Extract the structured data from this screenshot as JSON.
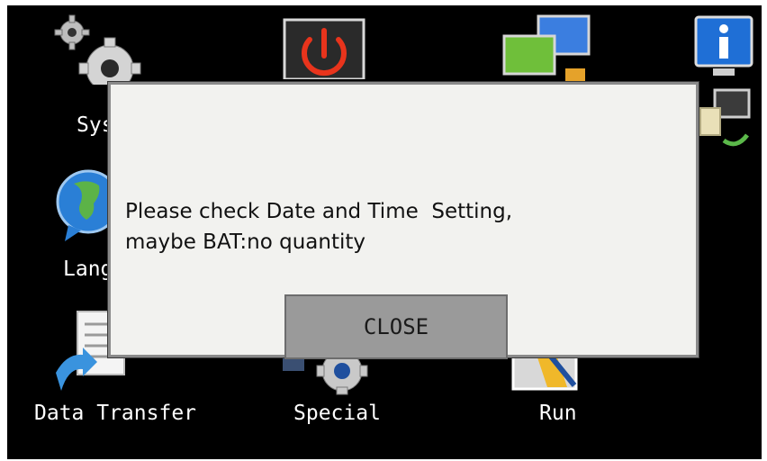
{
  "icons": {
    "system": {
      "label": "Sys",
      "icon": "gear-icon"
    },
    "power": {
      "icon": "power-icon"
    },
    "display": {
      "icon": "monitor-icon"
    },
    "info": {
      "icon": "info-icon"
    },
    "network": {
      "icon": "network-sync-icon"
    },
    "language": {
      "label": "Lang",
      "icon": "globe-icon"
    },
    "data_transfer": {
      "label": "Data Transfer",
      "icon": "document-transfer-icon"
    },
    "special": {
      "label": "Special",
      "icon": "gear-icon"
    },
    "run": {
      "label": "Run",
      "icon": "run-icon"
    }
  },
  "dialog": {
    "line1": "Please check Date and Time  Setting,",
    "line2": "maybe BAT:no quantity",
    "close_label": "CLOSE"
  },
  "colors": {
    "background": "#000000",
    "dialog_bg": "#f2f2ef",
    "button_bg": "#9a9a9a",
    "power_accent": "#e8341c",
    "info_blue": "#1f6fd6",
    "globe_blue": "#2a7fd6"
  }
}
